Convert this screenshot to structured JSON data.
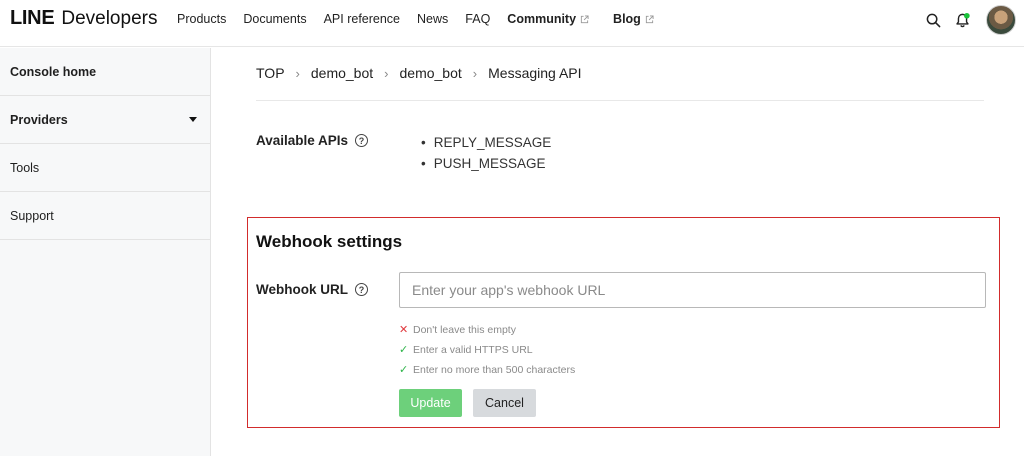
{
  "header": {
    "logo_line": "LINE",
    "logo_developers": "Developers",
    "nav": [
      {
        "label": "Products"
      },
      {
        "label": "Documents"
      },
      {
        "label": "API reference"
      },
      {
        "label": "News"
      },
      {
        "label": "FAQ"
      },
      {
        "label": "Community"
      },
      {
        "label": "Blog"
      }
    ]
  },
  "sidebar": {
    "items": [
      {
        "label": "Console home"
      },
      {
        "label": "Providers"
      },
      {
        "label": "Tools"
      },
      {
        "label": "Support"
      }
    ]
  },
  "breadcrumb": [
    "TOP",
    "demo_bot",
    "demo_bot",
    "Messaging API"
  ],
  "available_apis": {
    "label": "Available APIs",
    "items": [
      "REPLY_MESSAGE",
      "PUSH_MESSAGE"
    ]
  },
  "webhook": {
    "title": "Webhook settings",
    "url_label": "Webhook URL",
    "url_value": "",
    "url_placeholder": "Enter your app's webhook URL",
    "rules": [
      {
        "text": "Don't leave this empty",
        "status": "fail"
      },
      {
        "text": "Enter a valid HTTPS URL",
        "status": "pass"
      },
      {
        "text": "Enter no more than 500 characters",
        "status": "pass"
      }
    ],
    "update_label": "Update",
    "cancel_label": "Cancel"
  },
  "colors": {
    "highlight_border": "#d22c2c",
    "update_button": "#6dd07b",
    "cancel_button": "#d7dadd",
    "rule_fail": "#e0393e",
    "rule_pass": "#2fb44a",
    "notification_dot": "#19c23a"
  }
}
